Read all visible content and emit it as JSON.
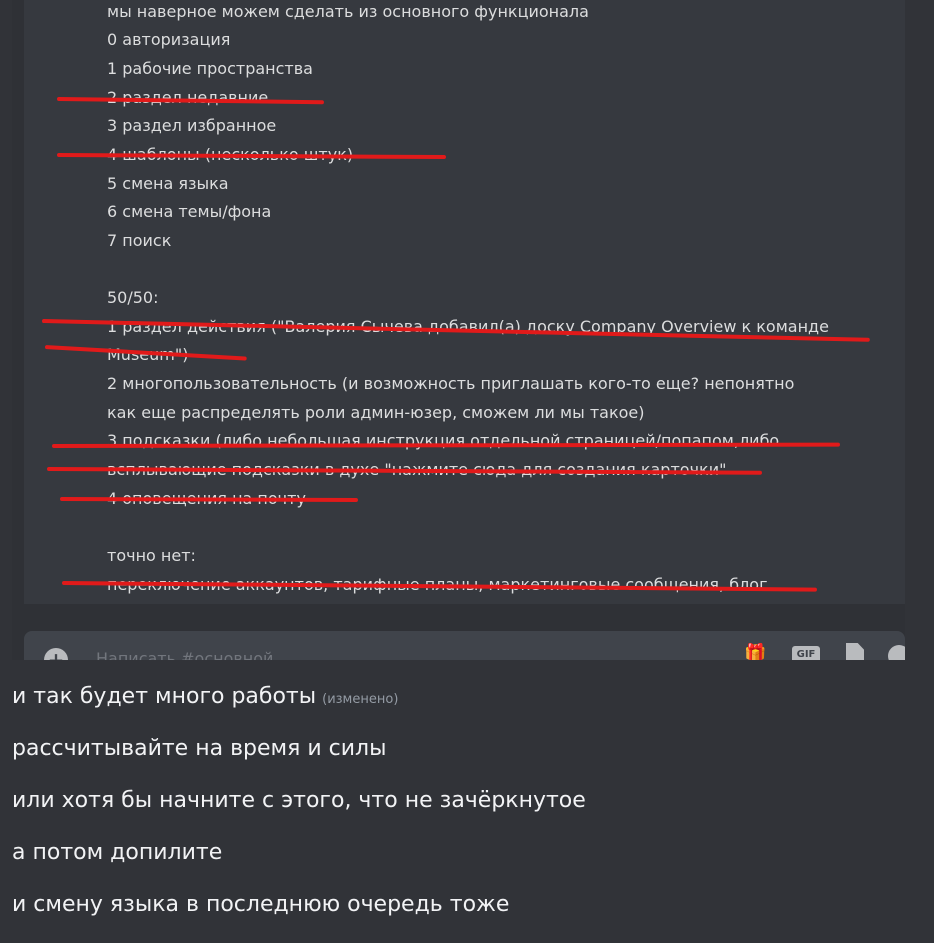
{
  "screenshot": {
    "lines": [
      "мы наверное можем сделать из основного функционала",
      "0 авторизация",
      "1 рабочие пространства",
      "2 раздел недавние",
      "3 раздел избранное",
      "4 шаблоны (несколько штук)",
      "5 смена языка",
      "6 смена темы/фона",
      "7 поиск",
      "50/50:",
      "1 раздел действия (\"Валерия Сычева добавил(а) доску Company Overview к команде",
      "Museum\")",
      "2 многопользовательность (и возможность приглашать кого-то еще? непонятно",
      "как еще распределять роли админ-юзер, сможем ли мы такое)",
      "3 подсказки (либо небольшая инструкция отдельной страницей/попапом,либо",
      "всплывающие подсказки в духе \"нажмите сюда для создания карточки\"",
      "4 оповещения на почту",
      "точно нет:",
      "переключение аккаунтов, тарифные планы, маркетинговые сообщения, блог"
    ],
    "composer_placeholder": "Написать #основной",
    "icons": [
      "plus-icon",
      "gift-icon",
      "gif-icon",
      "file-icon",
      "emoji-icon"
    ]
  },
  "messages": [
    {
      "text": "и так будет много работы",
      "edited": "(изменено)"
    },
    {
      "text": "рассчитывайте на время и силы"
    },
    {
      "text": "или хотя бы начните с этого, что не зачёркнутое"
    },
    {
      "text": "а потом допилите"
    },
    {
      "text": "и смену языка в последнюю очередь тоже"
    }
  ],
  "colors": {
    "strike": "#e11a1a",
    "background": "#313338"
  }
}
